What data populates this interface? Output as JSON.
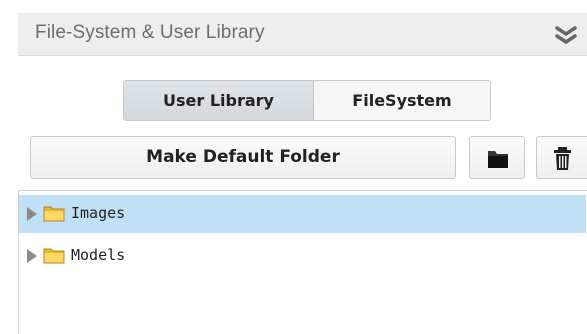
{
  "header": {
    "title": "File-System & User Library",
    "collapse_icon": "double-chevron-down-icon"
  },
  "tabs": [
    {
      "label": "User Library",
      "active": true
    },
    {
      "label": "FileSystem",
      "active": false
    }
  ],
  "toolbar": {
    "default_folder_label": "Make Default Folder",
    "folder_icon": "folder-icon",
    "trash_icon": "trash-icon"
  },
  "tree": {
    "items": [
      {
        "label": "Images",
        "icon": "folder-icon",
        "selected": true
      },
      {
        "label": "Models",
        "icon": "folder-icon",
        "selected": false
      }
    ]
  },
  "colors": {
    "selection": "#bfe0f5",
    "folder": "#f2c94c",
    "active_tab": "#d8dde2"
  }
}
